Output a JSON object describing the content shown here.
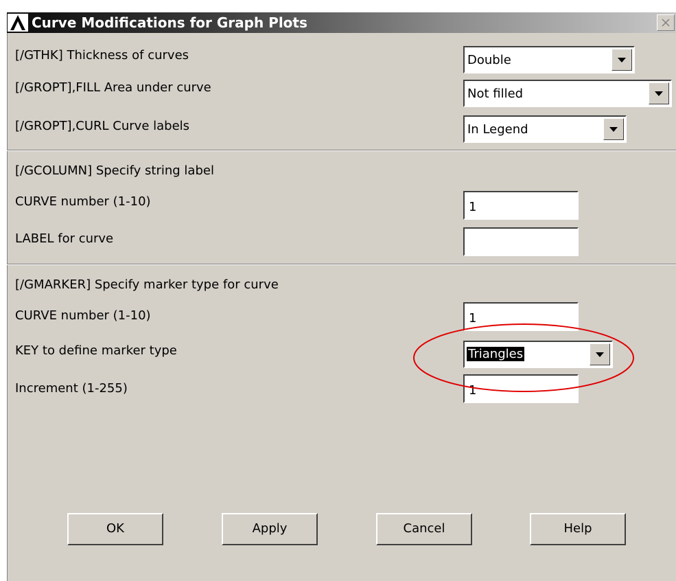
{
  "dialog": {
    "title": "Curve Modifications for Graph Plots"
  },
  "rows": {
    "gthk": {
      "label": "[/GTHK]  Thickness of curves",
      "value": "Double"
    },
    "fill": {
      "label": "[/GROPT],FILL  Area under curve",
      "value": "Not filled"
    },
    "curl": {
      "label": "[/GROPT],CURL  Curve labels",
      "value": "In Legend"
    }
  },
  "gcolumn": {
    "heading": "[/GCOLUMN] Specify string label",
    "curve_label": "CURVE number (1-10)",
    "curve_value": "1",
    "label_label": "LABEL for curve",
    "label_value": ""
  },
  "gmarker": {
    "heading": "[/GMARKER] Specify marker type for curve",
    "curve_label": "CURVE number (1-10)",
    "curve_value": "1",
    "key_label": "KEY to define marker type",
    "key_value": "Triangles",
    "inc_label": "Increment (1-255)",
    "inc_value": "1"
  },
  "buttons": {
    "ok": "OK",
    "apply": "Apply",
    "cancel": "Cancel",
    "help": "Help"
  },
  "colors": {
    "annotation_circle": "#e00000",
    "dialog_bg": "#d4d0c8"
  },
  "icons": {
    "app": "ansys-logo-icon",
    "close": "close-icon",
    "dropdown": "chevron-down-icon"
  }
}
